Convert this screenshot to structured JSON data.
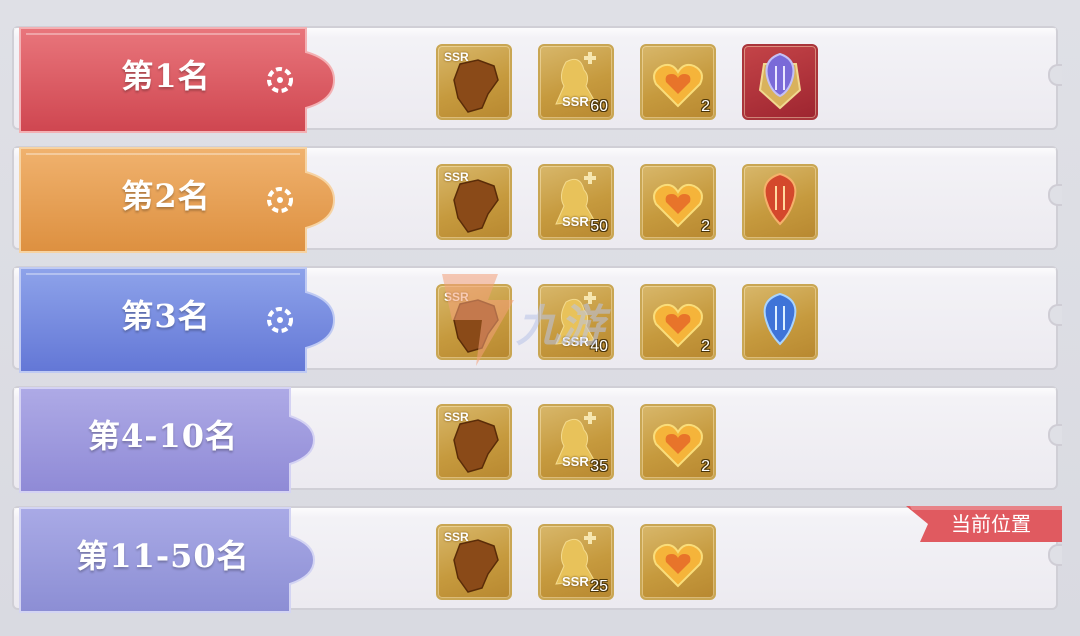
{
  "colors": {
    "rank1": "#d9545c",
    "rank2": "#e09a4c",
    "rank3": "#6f86db",
    "rank4": "#9a94da",
    "rank5": "#8f92d6",
    "badge": "#e05a60"
  },
  "rows": [
    {
      "rank": "第1名",
      "rewards": [
        {
          "icon": "ssr-map-fragment-icon",
          "badge": "SSR"
        },
        {
          "icon": "ssr-character-shard-icon",
          "badge": "SSR",
          "qty": "60"
        },
        {
          "icon": "golden-heart-gem-icon",
          "qty": "2"
        },
        {
          "icon": "purple-lyre-emblem-icon"
        }
      ]
    },
    {
      "rank": "第2名",
      "rewards": [
        {
          "icon": "ssr-map-fragment-icon",
          "badge": "SSR"
        },
        {
          "icon": "ssr-character-shard-icon",
          "badge": "SSR",
          "qty": "50"
        },
        {
          "icon": "golden-heart-gem-icon",
          "qty": "2"
        },
        {
          "icon": "red-lyre-emblem-icon"
        }
      ]
    },
    {
      "rank": "第3名",
      "rewards": [
        {
          "icon": "ssr-map-fragment-icon",
          "badge": "SSR"
        },
        {
          "icon": "ssr-character-shard-icon",
          "badge": "SSR",
          "qty": "40"
        },
        {
          "icon": "golden-heart-gem-icon",
          "qty": "2"
        },
        {
          "icon": "blue-lyre-emblem-icon"
        }
      ]
    },
    {
      "rank": "第4-10名",
      "rewards": [
        {
          "icon": "ssr-map-fragment-icon",
          "badge": "SSR"
        },
        {
          "icon": "ssr-character-shard-icon",
          "badge": "SSR",
          "qty": "35"
        },
        {
          "icon": "golden-heart-gem-icon",
          "qty": "2"
        }
      ]
    },
    {
      "rank": "第11-50名",
      "rewards": [
        {
          "icon": "ssr-map-fragment-icon",
          "badge": "SSR"
        },
        {
          "icon": "ssr-character-shard-icon",
          "badge": "SSR",
          "qty": "25"
        },
        {
          "icon": "golden-heart-gem-icon"
        }
      ]
    }
  ],
  "current_position_badge": "当前位置",
  "watermark": "九游"
}
